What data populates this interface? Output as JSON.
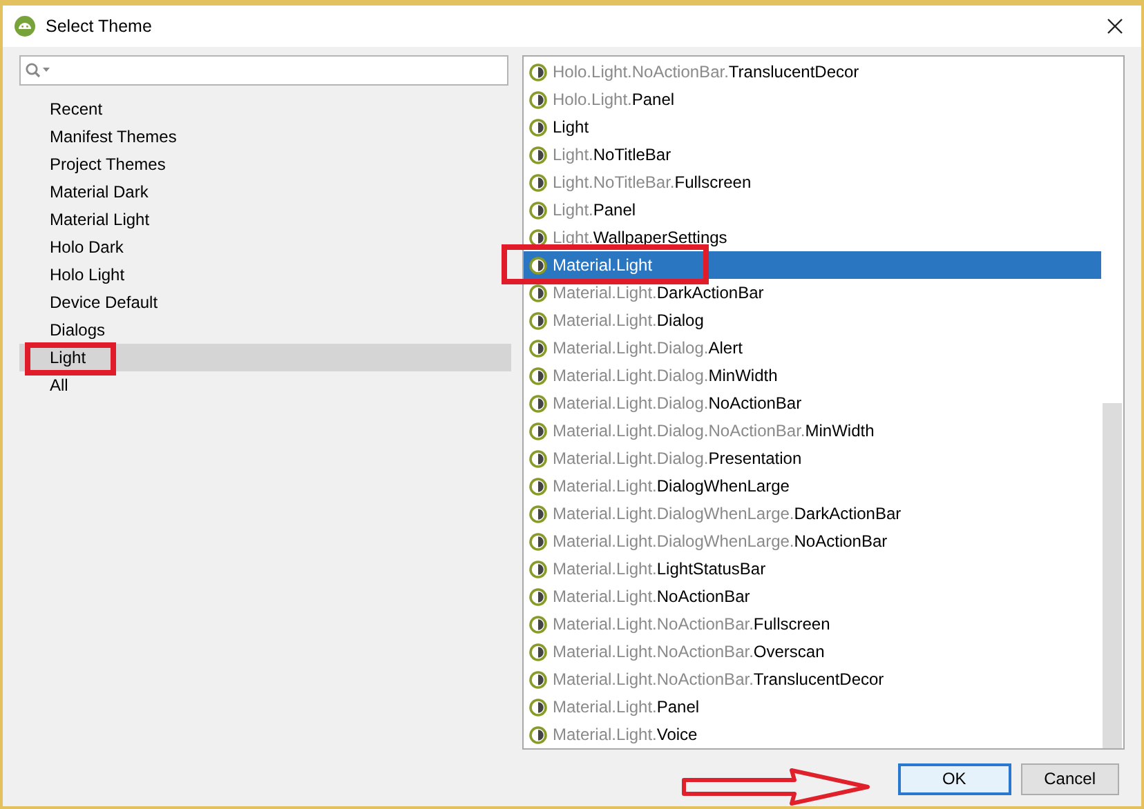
{
  "window": {
    "title": "Select Theme"
  },
  "categories": [
    {
      "label": "Recent",
      "selected": false,
      "marked": false
    },
    {
      "label": "Manifest Themes",
      "selected": false,
      "marked": false
    },
    {
      "label": "Project Themes",
      "selected": false,
      "marked": false
    },
    {
      "label": "Material Dark",
      "selected": false,
      "marked": false
    },
    {
      "label": "Material Light",
      "selected": false,
      "marked": false
    },
    {
      "label": "Holo Dark",
      "selected": false,
      "marked": false
    },
    {
      "label": "Holo Light",
      "selected": false,
      "marked": false
    },
    {
      "label": "Device Default",
      "selected": false,
      "marked": false
    },
    {
      "label": "Dialogs",
      "selected": false,
      "marked": false
    },
    {
      "label": "Light",
      "selected": true,
      "marked": true
    },
    {
      "label": "All",
      "selected": false,
      "marked": false
    }
  ],
  "themes": [
    {
      "prefix": "Holo.Light.NoActionBar.",
      "name": "TranslucentDecor",
      "selected": false,
      "marked": false
    },
    {
      "prefix": "Holo.Light.",
      "name": "Panel",
      "selected": false,
      "marked": false
    },
    {
      "name": "Light",
      "selected": false,
      "marked": false
    },
    {
      "prefix": "Light.",
      "name": "NoTitleBar",
      "selected": false,
      "marked": false
    },
    {
      "prefix": "Light.NoTitleBar.",
      "name": "Fullscreen",
      "selected": false,
      "marked": false
    },
    {
      "prefix": "Light.",
      "name": "Panel",
      "selected": false,
      "marked": false
    },
    {
      "prefix": "Light.",
      "name": "WallpaperSettings",
      "selected": false,
      "marked": false
    },
    {
      "name": "Material.Light",
      "selected": true,
      "marked": true
    },
    {
      "prefix": "Material.Light.",
      "name": "DarkActionBar",
      "selected": false,
      "marked": false
    },
    {
      "prefix": "Material.Light.",
      "name": "Dialog",
      "selected": false,
      "marked": false
    },
    {
      "prefix": "Material.Light.Dialog.",
      "name": "Alert",
      "selected": false,
      "marked": false
    },
    {
      "prefix": "Material.Light.Dialog.",
      "name": "MinWidth",
      "selected": false,
      "marked": false
    },
    {
      "prefix": "Material.Light.Dialog.",
      "name": "NoActionBar",
      "selected": false,
      "marked": false
    },
    {
      "prefix": "Material.Light.Dialog.NoActionBar.",
      "name": "MinWidth",
      "selected": false,
      "marked": false
    },
    {
      "prefix": "Material.Light.Dialog.",
      "name": "Presentation",
      "selected": false,
      "marked": false
    },
    {
      "prefix": "Material.Light.",
      "name": "DialogWhenLarge",
      "selected": false,
      "marked": false
    },
    {
      "prefix": "Material.Light.DialogWhenLarge.",
      "name": "DarkActionBar",
      "selected": false,
      "marked": false
    },
    {
      "prefix": "Material.Light.DialogWhenLarge.",
      "name": "NoActionBar",
      "selected": false,
      "marked": false
    },
    {
      "prefix": "Material.Light.",
      "name": "LightStatusBar",
      "selected": false,
      "marked": false
    },
    {
      "prefix": "Material.Light.",
      "name": "NoActionBar",
      "selected": false,
      "marked": false
    },
    {
      "prefix": "Material.Light.NoActionBar.",
      "name": "Fullscreen",
      "selected": false,
      "marked": false
    },
    {
      "prefix": "Material.Light.NoActionBar.",
      "name": "Overscan",
      "selected": false,
      "marked": false
    },
    {
      "prefix": "Material.Light.NoActionBar.",
      "name": "TranslucentDecor",
      "selected": false,
      "marked": false
    },
    {
      "prefix": "Material.Light.",
      "name": "Panel",
      "selected": false,
      "marked": false
    },
    {
      "prefix": "Material.Light.",
      "name": "Voice",
      "selected": false,
      "marked": false
    }
  ],
  "buttons": [
    {
      "label": "OK",
      "default": true,
      "marked": true
    },
    {
      "label": "Cancel",
      "default": false,
      "marked": false
    }
  ]
}
